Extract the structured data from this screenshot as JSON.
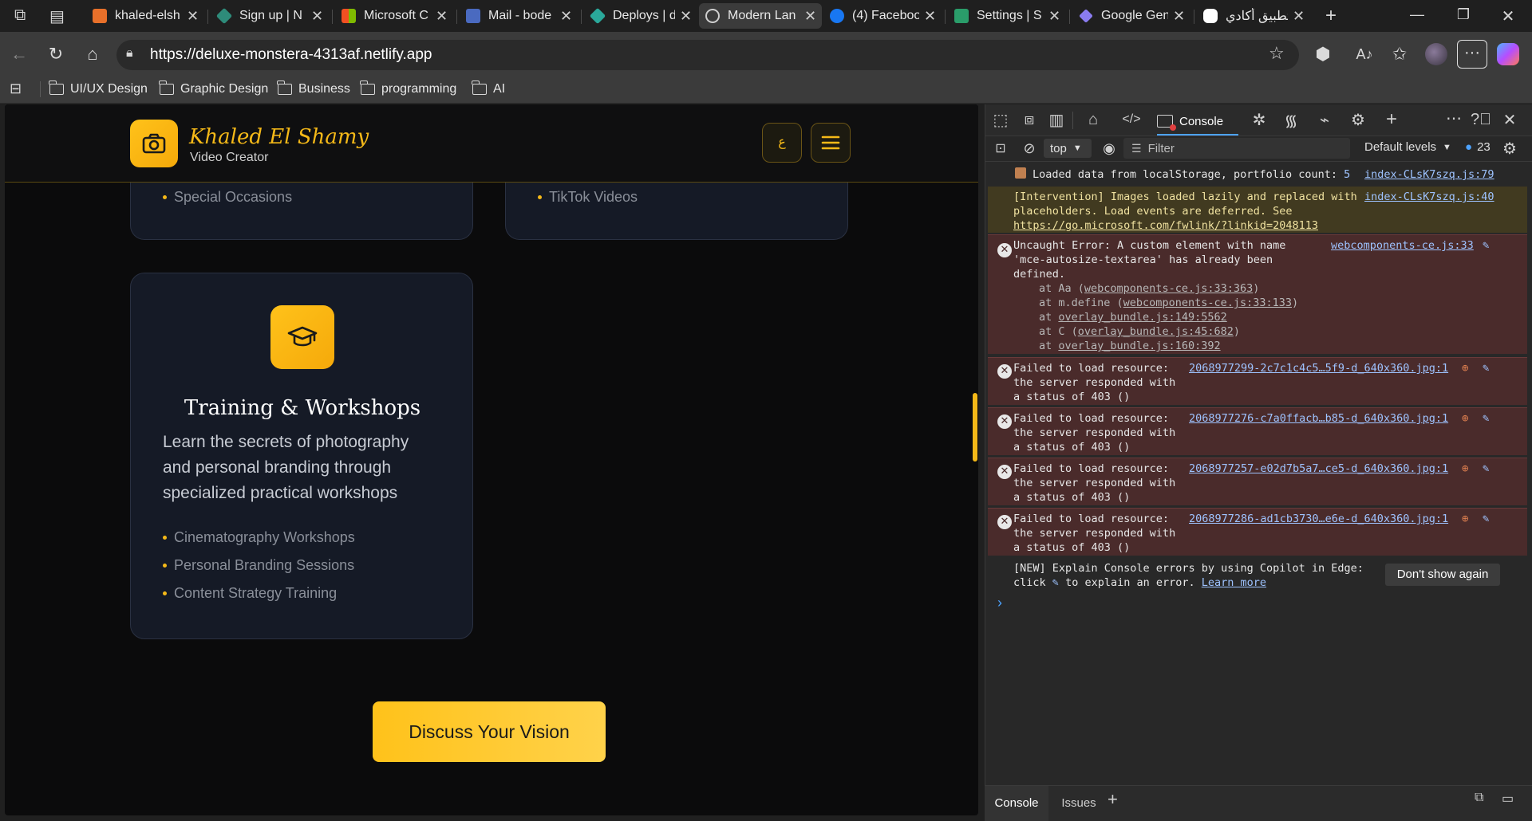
{
  "browser": {
    "tabs": [
      {
        "label": "khaled-elsh",
        "color": "#e8702a"
      },
      {
        "label": "Sign up | N",
        "color": "#2e8b7a"
      },
      {
        "label": "Microsoft C",
        "color": "#d04a2a"
      },
      {
        "label": "Mail - bode",
        "color": "#4a6ac0"
      },
      {
        "label": "Deploys | d",
        "color": "#2aa89a"
      },
      {
        "label": "Modern Lan",
        "color": "#bdbdbd"
      },
      {
        "label": "(4) Faceboo",
        "color": "#1877f2"
      },
      {
        "label": "Settings | S",
        "color": "#2a9d6a"
      },
      {
        "label": "Google Gen",
        "color": "#8a7cf0"
      },
      {
        "label": "تطبيق أكادي",
        "color": "#ffffff"
      }
    ],
    "url": "https://deluxe-monstera-4313af.netlify.app",
    "bookmarks": [
      "UI/UX Design",
      "Graphic Design",
      "Business",
      "programming",
      "AI"
    ]
  },
  "site": {
    "brand_name": "Khaled El Shamy",
    "brand_tagline": "Video Creator",
    "lang_toggle": "ع",
    "colors": {
      "accent": "#f5b918",
      "card_bg": "#151a26",
      "page_bg": "#0b0b0c"
    },
    "card_top_left_item": "Special Occasions",
    "card_top_right_item": "TikTok Videos",
    "training_card": {
      "title": "Training & Workshops",
      "description": "Learn the secrets of photography and personal branding through specialized practical workshops",
      "items": [
        "Cinematography Workshops",
        "Personal Branding Sessions",
        "Content Strategy Training"
      ]
    },
    "cta_button": "Discuss Your Vision"
  },
  "devtools": {
    "active_tab": "Console",
    "filter_context": "top",
    "filter_placeholder": "Filter",
    "levels": "Default levels",
    "issue_count": "23",
    "messages": {
      "m1": {
        "text": "Loaded data from localStorage, portfolio count:",
        "count": "5",
        "src": "index-CLsK7szq.js:79"
      },
      "m2": {
        "text": "[Intervention] Images loaded lazily and replaced with placeholders. Load events are deferred. See",
        "link": "https://go.microsoft.com/fwlink/?linkid=2048113",
        "src": "index-CLsK7szq.js:40"
      },
      "m3": {
        "line1": "Uncaught Error: A custom element with name",
        "line2": "'mce-autosize-textarea' has already been",
        "line3": "defined.",
        "src": "webcomponents-ce.js:33",
        "stack": [
          {
            "pre": "at Aa (",
            "link": "webcomponents-ce.js:33:363",
            "post": ")"
          },
          {
            "pre": "at m.define (",
            "link": "webcomponents-ce.js:33:133",
            "post": ")"
          },
          {
            "pre": "at ",
            "link": "overlay_bundle.js:149:5562",
            "post": ""
          },
          {
            "pre": "at C (",
            "link": "overlay_bundle.js:45:682",
            "post": ")"
          },
          {
            "pre": "at ",
            "link": "overlay_bundle.js:160:392",
            "post": ""
          }
        ]
      },
      "fail_line1": "Failed to load resource:",
      "fail_line2": "the server responded with",
      "fail_line3": "a status of 403 ()",
      "fail_srcs": [
        "2068977299-2c7c1c4c5…5f9-d_640x360.jpg:1",
        "2068977276-c7a0ffacb…b85-d_640x360.jpg:1",
        "2068977257-e02d7b5a7…ce5-d_640x360.jpg:1",
        "2068977286-ad1cb3730…e6e-d_640x360.jpg:1"
      ],
      "copilot_line1": "[NEW] Explain Console errors by using Copilot in Edge:",
      "copilot_line2a": "click",
      "copilot_line2b": "to explain an error.",
      "copilot_link": "Learn more",
      "dont_show": "Don't show again"
    },
    "bottom_tabs": [
      "Console",
      "Issues"
    ]
  }
}
